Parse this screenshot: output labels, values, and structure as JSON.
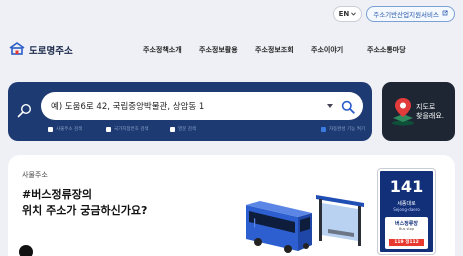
{
  "topbar": {
    "language": "EN",
    "support_service": "주소기반산업지원서비스"
  },
  "logo": {
    "text": "도로명주소"
  },
  "nav": {
    "items": [
      {
        "label": "주소정책소개"
      },
      {
        "label": "주소정보활용"
      },
      {
        "label": "주소정보조회"
      },
      {
        "label": "주소이야기"
      },
      {
        "label": "주소소통마당"
      }
    ]
  },
  "search": {
    "value": "예) 도움6로 42, 국립중앙박물관, 상암동 1",
    "options": [
      {
        "label": "사물주소 검색",
        "checked": false
      },
      {
        "label": "국가지점번호 검색",
        "checked": false
      },
      {
        "label": "영문 검색",
        "checked": false
      },
      {
        "label": "자동완성 기능 켜기",
        "checked": true
      }
    ]
  },
  "map_card": {
    "line1": "지도로",
    "line2": "찾을래요."
  },
  "feature": {
    "label": "사물주소",
    "headline_line1": "#버스정류장의",
    "headline_line2": "위치 주소가 궁금하신가요?"
  },
  "bus_sign": {
    "number": "141",
    "road_name": "세종대로",
    "road_name_en": "Sejong-daero",
    "stop_name": "버스정류장",
    "stop_name_en": "Bus stop",
    "code": "119 정112"
  },
  "colors": {
    "search_panel_bg": "#1d3a73",
    "map_card_bg": "#1e2633",
    "accent_blue": "#3b7be0",
    "sign_red": "#e8392f"
  }
}
